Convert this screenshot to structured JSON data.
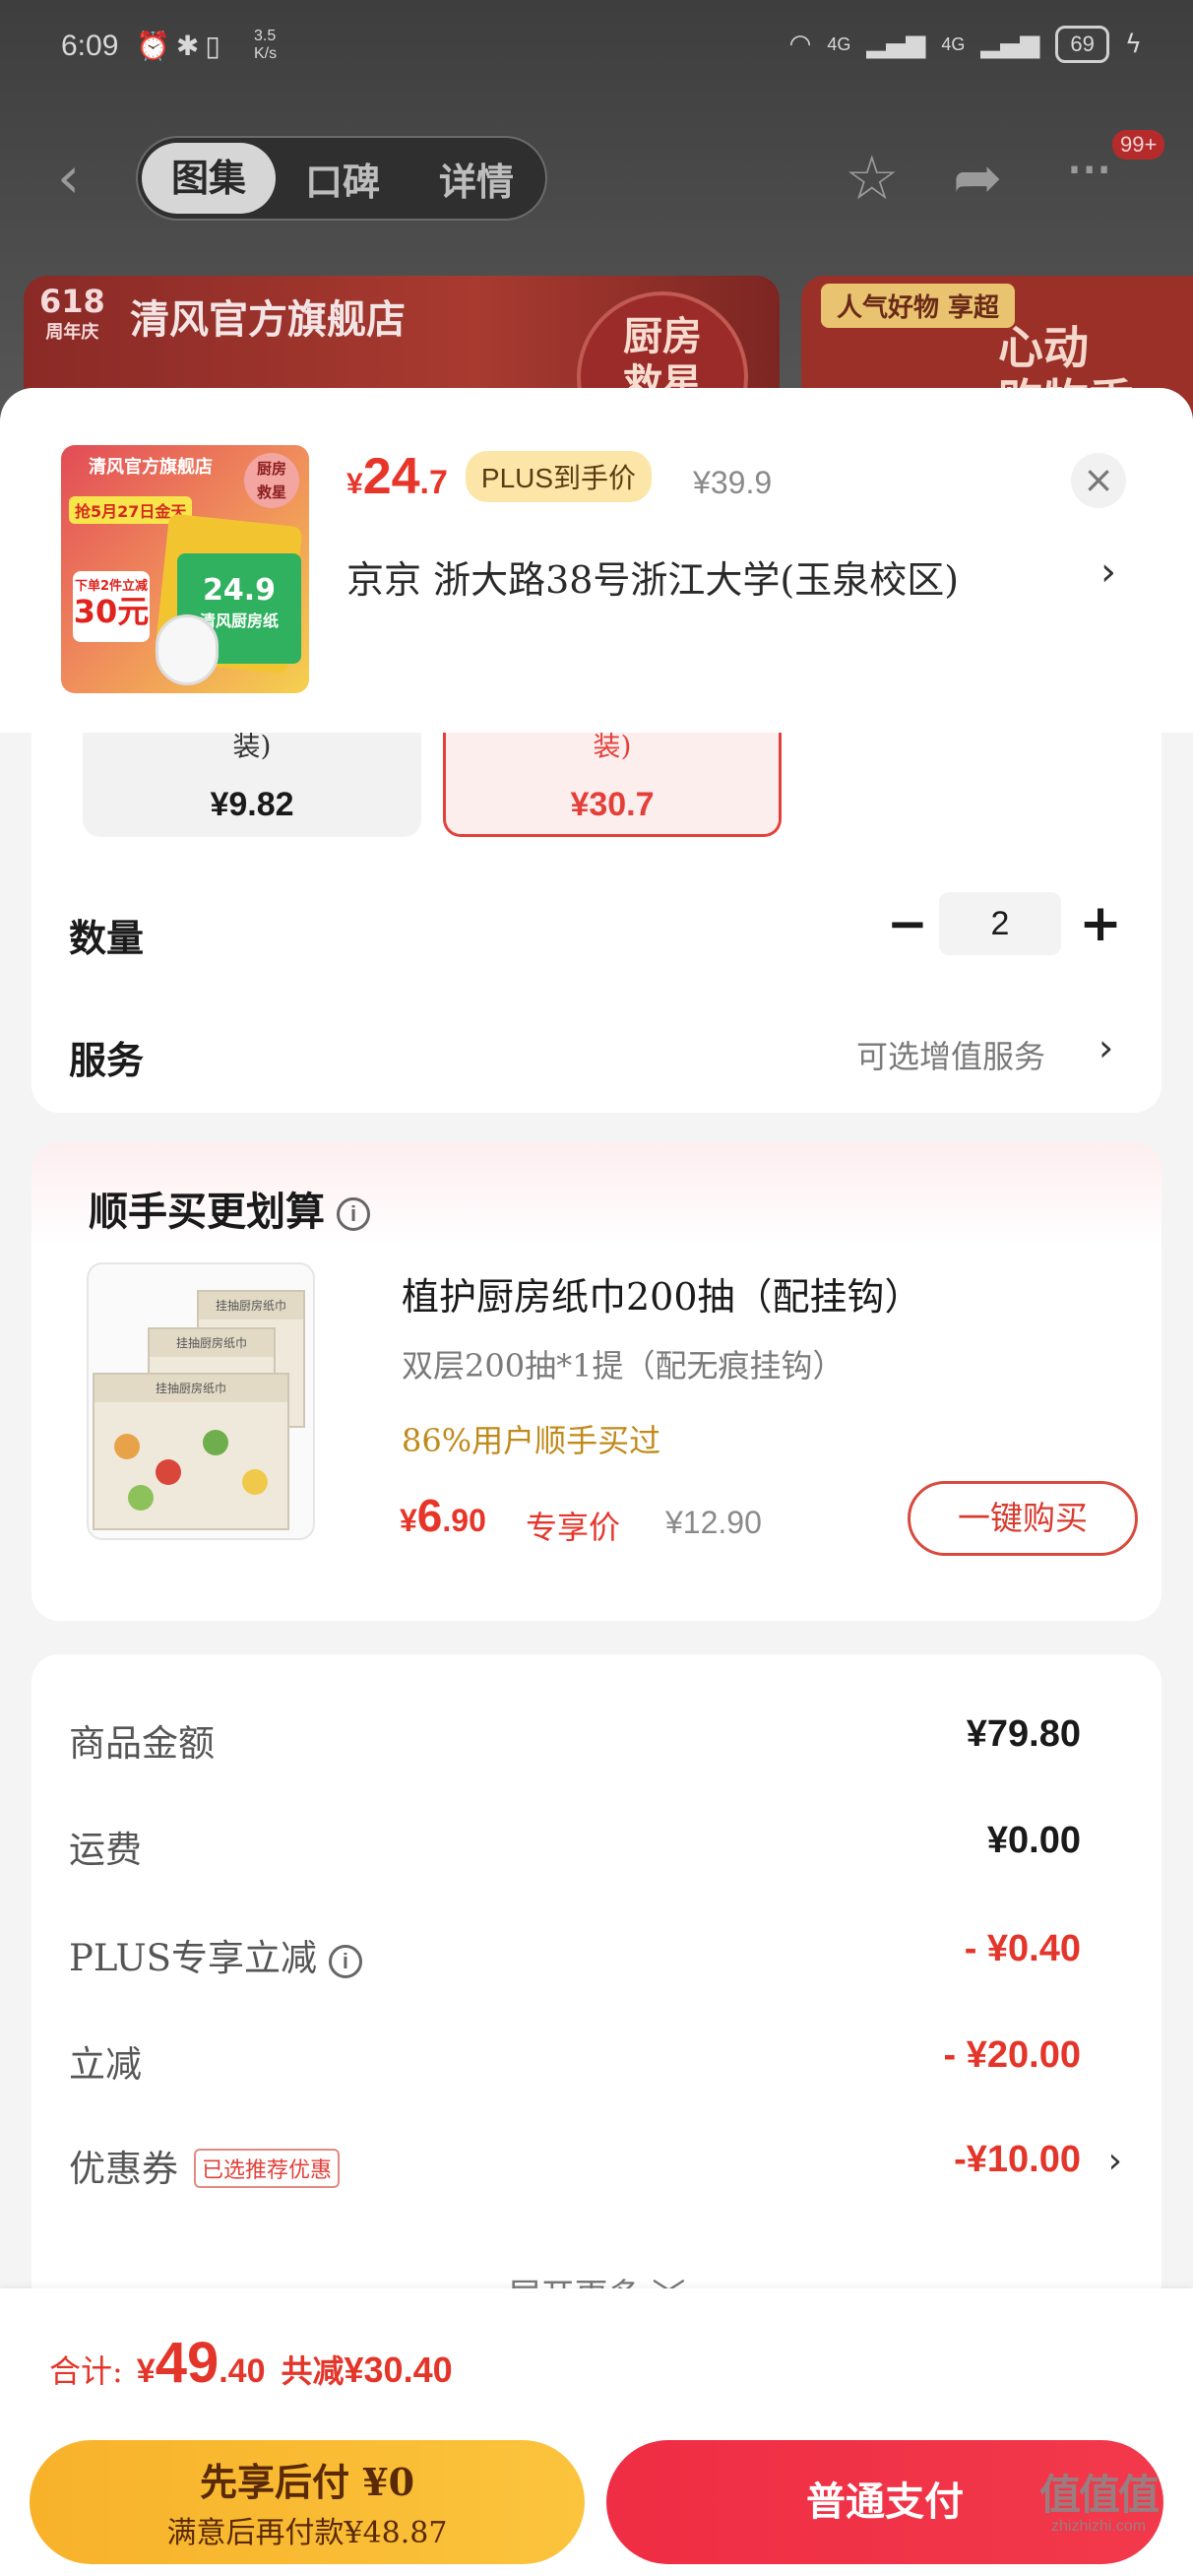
{
  "status_bar": {
    "time": "6:09",
    "speed": "3.5\nK/s",
    "left_icons": "⏰✱▯",
    "network_1": "4G",
    "network_2": "4G",
    "battery": "69"
  },
  "nav": {
    "tabs": [
      {
        "label": "图集",
        "active": true
      },
      {
        "label": "口碑",
        "active": false
      },
      {
        "label": "详情",
        "active": false
      }
    ],
    "more_badge": "99+"
  },
  "background_banners": {
    "banner1_618": "618",
    "banner1_618_sub": "周年庆",
    "banner1_store": "清风官方旗舰店",
    "banner1_circle": "厨房\n救星",
    "banner2_tag": "人气好物 享超",
    "banner2_big": "心动\n购物季"
  },
  "product": {
    "thumb": {
      "store": "清风官方旗舰店",
      "tag": "抢5月27日金天",
      "price_note": "下单2件立减",
      "price_value": "30元",
      "kitchen": "厨房\n救星",
      "card_text": "清风厨房纸",
      "card_price": "24.9"
    },
    "price_symbol": "¥",
    "price_int": "24",
    "price_dec": ".7",
    "plus_badge": "PLUS到手价",
    "original_price": "¥39.9",
    "address": "京京   浙大路38号浙江大学(玉泉校区)"
  },
  "options": {
    "specs": [
      {
        "fragment": "装)",
        "price": "¥9.82",
        "selected": false
      },
      {
        "fragment": "装)",
        "price": "¥30.7",
        "selected": true
      }
    ],
    "quantity_label": "数量",
    "quantity_value": "2",
    "service_label": "服务",
    "service_value": "可选增值服务"
  },
  "upsell": {
    "title": "顺手买更划算",
    "name": "植护厨房纸巾200抽（配挂钩）",
    "spec": "双层200抽*1提（配无痕挂钩）",
    "stat": "86%用户顺手买过",
    "price_symbol": "¥",
    "price_int": "6",
    "price_dec": ".90",
    "exclusive_label": "专享价",
    "original_price": "¥12.90",
    "buy_button": "一键购买",
    "box_label": "挂抽厨房纸巾"
  },
  "summary": {
    "rows": [
      {
        "label": "商品金额",
        "value": "¥79.80",
        "red": false
      },
      {
        "label": "运费",
        "value": "¥0.00",
        "red": false
      },
      {
        "label": "PLUS专享立减",
        "value": "- ¥0.40",
        "red": true
      },
      {
        "label": "立减",
        "value": "- ¥20.00",
        "red": true
      },
      {
        "label": "优惠券",
        "value": "-¥10.00",
        "red": true,
        "tag": "已选推荐优惠"
      }
    ],
    "expand_more": "展开更多 ﹀"
  },
  "bottom_bar": {
    "total_label": "合计:",
    "total_symbol": "¥",
    "total_int": "49",
    "total_dec": ".40",
    "saved_label": "共减",
    "saved_value": "¥30.40",
    "pay_later_title": "先享后付 ¥0",
    "pay_later_sub": "满意后再付款¥48.87",
    "pay_normal": "普通支付"
  },
  "watermark": {
    "brand": "值值值",
    "site": "zhizhizhi.com"
  },
  "colors": {
    "accent_red": "#e8352a",
    "pay_later_yellow": "#fbc43c",
    "pay_normal_red": "#ef2d44",
    "plus_gold": "#fbe6a8"
  }
}
